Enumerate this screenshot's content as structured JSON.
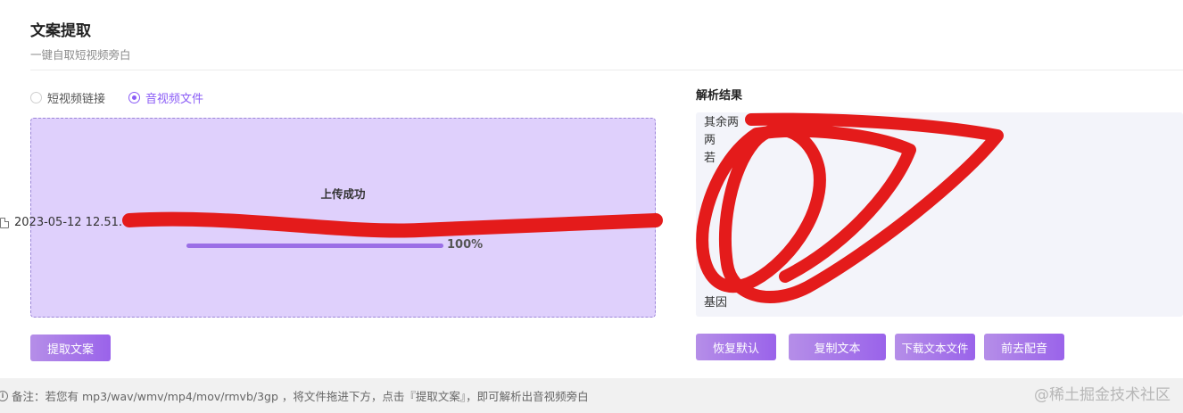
{
  "header": {
    "title": "文案提取",
    "subtitle": "一键自取短视频旁白"
  },
  "source_options": [
    {
      "label": "短视频链接",
      "checked": false
    },
    {
      "label": "音视频文件",
      "checked": true
    }
  ],
  "upload": {
    "status": "上传成功",
    "progress": 100,
    "progress_text": "100%",
    "file_name": "2023-05-12 12.51.0"
  },
  "actions": {
    "extract_label": "提取文案"
  },
  "result": {
    "label": "解析结果",
    "lines": [
      "其余两",
      "两",
      "若",
      "",
      "",
      "",
      "",
      "",
      "",
      "",
      "基因"
    ]
  },
  "result_actions": {
    "reset_label": "恢复默认",
    "copy_label": "复制文本",
    "download_label": "下载文本文件",
    "dub_label": "前去配音"
  },
  "footer": {
    "note": "备注：若您有 mp3/wav/wmv/mp4/mov/rmvb/3gp ，将文件拖进下方，点击『提取文案』，即可解析出音视频旁白",
    "watermark": "@稀土掘金技术社区"
  },
  "colors": {
    "accent": "#8b5cf6",
    "upload_bg": "#dfd0fc",
    "scribble": "#e41b1b"
  }
}
